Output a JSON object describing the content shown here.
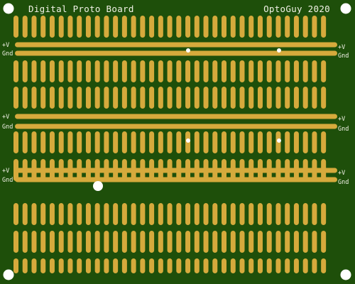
{
  "board": {
    "title": "Digital Proto Board",
    "credit": "OptoGuy 2020",
    "power_label": "+V",
    "ground_label": "Gnd",
    "colors": {
      "substrate": "#1e4f0a",
      "copper": "#d6aa3c",
      "silkscreen": "#f2f2e6",
      "drill": "#ffffff"
    },
    "pad_columns": 35,
    "strip_rows": 8,
    "power_rail_pairs": 3
  }
}
